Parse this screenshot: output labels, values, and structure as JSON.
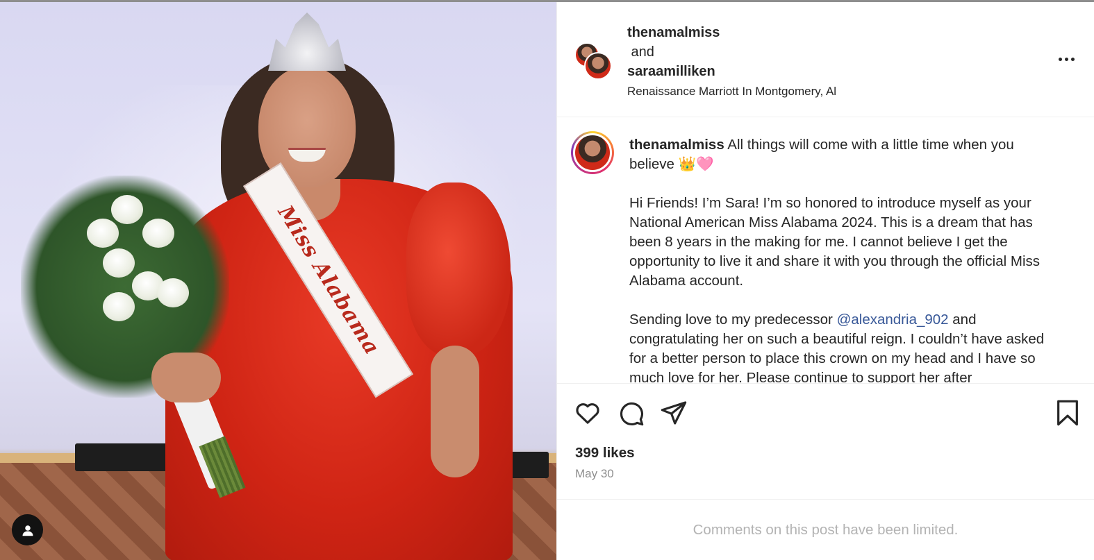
{
  "post": {
    "header": {
      "user1": "thenamalmiss",
      "joiner": " and",
      "user2": "saraamilliken",
      "location": "Renaissance Marriott In Montgomery, Al"
    },
    "media": {
      "sash_text": "Miss Alabama"
    },
    "caption": {
      "username": "thenamalmiss",
      "line1": " All things will come with a little time when you believe 👑🩷",
      "para2": "Hi Friends! I’m Sara! I’m so honored to introduce myself as your National American Miss Alabama 2024. This is a dream that has been 8 years in the making for me. I cannot believe I get the opportunity to live it and share it with you through the official Miss Alabama account.",
      "para3_before": "Sending love to my predecessor ",
      "para3_mention": "@alexandria_902",
      "para3_after": " and congratulating her on such a beautiful reign. I couldn’t have asked for a better person to place this crown on my head and I have so much love for her. Please continue to support her after"
    },
    "icons": {
      "like": "heart-icon",
      "comment": "comment-icon",
      "share": "send-icon",
      "save": "bookmark-icon",
      "more": "more-icon",
      "tag": "user-tag-icon"
    },
    "likes": "399 likes",
    "date": "May 30",
    "comments_notice": "Comments on this post have been limited."
  }
}
